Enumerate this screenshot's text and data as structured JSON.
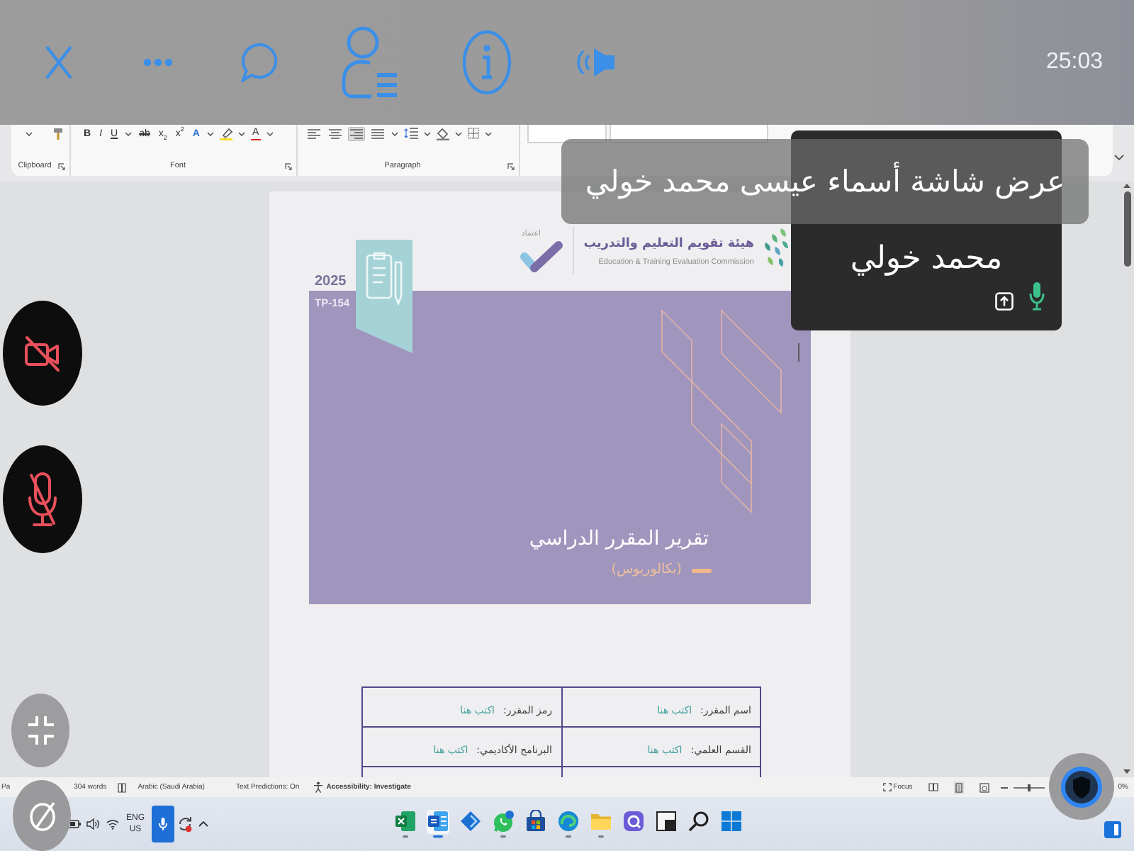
{
  "call_bar": {
    "timer": "25:03"
  },
  "screen_share_notice": {
    "text": "عرض شاشة أسماء عيسى محمد خولي"
  },
  "participant_tile": {
    "name": "محمد خولي",
    "mic_on": true
  },
  "my_controls": {
    "camera_on": false,
    "microphone_on": false
  },
  "word_ribbon": {
    "clipboard_label": "Clipboard",
    "font_label": "Font",
    "paragraph_label": "Paragraph",
    "font_buttons": {
      "bold": {
        "kind": "bold",
        "label": "B",
        "menu": false
      },
      "italic": {
        "kind": "italic",
        "label": "I",
        "menu": false
      },
      "underline": {
        "kind": "underline",
        "label": "U",
        "menu": true
      },
      "strikethrough": {
        "kind": "strikethrough",
        "label": "ab",
        "menu": false
      },
      "subscript": {
        "kind": "subscript",
        "label": "x$_{2}$",
        "menu": false
      },
      "superscript": {
        "kind": "superscript",
        "label": "x$^{2}$",
        "menu": false
      },
      "text_effects": {
        "kind": "text_effects",
        "label": "A",
        "menu": true
      },
      "highlight": {
        "kind": "highlight",
        "menu": true
      },
      "font_color": {
        "kind": "font_color",
        "label": "A",
        "menu": true
      }
    },
    "alignment_buttons": [
      {
        "kind": "align_left",
        "selected": false,
        "menu": false
      },
      {
        "kind": "align_center",
        "selected": false,
        "menu": false
      },
      {
        "kind": "align_right",
        "selected": true,
        "menu": false
      },
      {
        "kind": "justify",
        "selected": false,
        "menu": true
      }
    ],
    "paragraph_buttons": [
      {
        "kind": "line_spacing",
        "menu": true
      },
      {
        "kind": "shading",
        "menu": true
      },
      {
        "kind": "borders",
        "menu": true
      }
    ]
  },
  "document_page": {
    "year": "2025",
    "code": "TP-154",
    "accreditation": "اعتماد",
    "org_name": "هيئة تقويم التعليم والتدريب",
    "org_name_english": "Education & Training Evaluation Commission",
    "title": "تقرير المقرر الدراسي",
    "subtitle": "(بكالوريوس)",
    "info_table": {
      "rows": [
        [
          {
            "label": "اسم المقرر:",
            "value": "اكتب هنا"
          },
          {
            "label": "رمز المقرر:",
            "value": "اكتب هنا"
          }
        ],
        [
          {
            "label": "القسم العلمي:",
            "value": "اكتب هنا"
          },
          {
            "label": "البرنامج الأكاديمي:",
            "value": "اكتب هنا"
          }
        ]
      ]
    }
  },
  "status_bar": {
    "page": "Pa",
    "word_count": "304 words",
    "language": "Arabic (Saudi Arabia)",
    "text_predictions": "Text Predictions: On",
    "accessibility": "Accessibility: Investigate",
    "focus": "Focus",
    "views": [
      {
        "kind": "read",
        "selected": false
      },
      {
        "kind": "print",
        "selected": true
      },
      {
        "kind": "web",
        "selected": false
      }
    ],
    "zoom_slider": {
      "level": 0.5
    },
    "zoom": "0%"
  },
  "taskbar": {
    "language": "ENG",
    "region": "US",
    "apps": [
      {
        "kind": "spreadsheet",
        "running": true,
        "selected": false
      },
      {
        "kind": "document",
        "running": true,
        "selected": true
      },
      {
        "kind": "diamond",
        "running": false,
        "selected": false
      },
      {
        "kind": "phone_chat",
        "running": true,
        "selected": false
      },
      {
        "kind": "store",
        "running": false,
        "selected": false
      },
      {
        "kind": "browser",
        "running": true,
        "selected": false
      },
      {
        "kind": "folder",
        "running": true,
        "selected": false
      },
      {
        "kind": "chat",
        "running": false,
        "selected": false
      },
      {
        "kind": "square",
        "running": false,
        "selected": false
      },
      {
        "kind": "search",
        "running": false,
        "selected": false
      },
      {
        "kind": "start",
        "running": false,
        "selected": false
      }
    ]
  }
}
